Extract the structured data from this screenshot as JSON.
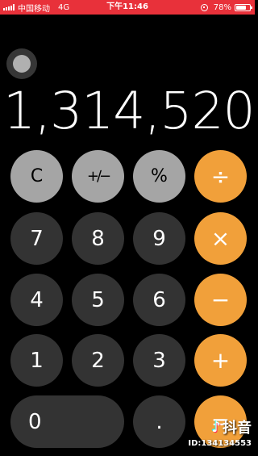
{
  "status_bar": {
    "carrier": "中国移动",
    "network": "4G",
    "time": "下午11:46",
    "battery": "78%",
    "battery_level": 0.78,
    "background_color": "#e8313a"
  },
  "display": {
    "value": "1,314,520"
  },
  "keypad": {
    "rows": [
      [
        {
          "label": "C",
          "name": "clear-button",
          "style": "gray"
        },
        {
          "label": "+∕−",
          "name": "plus-minus-button",
          "style": "gray"
        },
        {
          "label": "%",
          "name": "percent-button",
          "style": "gray"
        },
        {
          "label": "÷",
          "name": "divide-button",
          "style": "orange"
        }
      ],
      [
        {
          "label": "7",
          "name": "digit-7-button",
          "style": "dark"
        },
        {
          "label": "8",
          "name": "digit-8-button",
          "style": "dark"
        },
        {
          "label": "9",
          "name": "digit-9-button",
          "style": "dark"
        },
        {
          "label": "×",
          "name": "multiply-button",
          "style": "orange"
        }
      ],
      [
        {
          "label": "4",
          "name": "digit-4-button",
          "style": "dark"
        },
        {
          "label": "5",
          "name": "digit-5-button",
          "style": "dark"
        },
        {
          "label": "6",
          "name": "digit-6-button",
          "style": "dark"
        },
        {
          "label": "−",
          "name": "minus-button",
          "style": "orange"
        }
      ],
      [
        {
          "label": "1",
          "name": "digit-1-button",
          "style": "dark"
        },
        {
          "label": "2",
          "name": "digit-2-button",
          "style": "dark"
        },
        {
          "label": "3",
          "name": "digit-3-button",
          "style": "dark"
        },
        {
          "label": "+",
          "name": "plus-button",
          "style": "orange"
        }
      ],
      [
        {
          "label": "0",
          "name": "digit-0-button",
          "style": "dark"
        },
        {
          "label": ".",
          "name": "decimal-button",
          "style": "dark"
        },
        {
          "label": "=",
          "name": "equals-button",
          "style": "orange"
        }
      ]
    ]
  },
  "colors": {
    "function_key": "#a5a5a5",
    "digit_key": "#333333",
    "operator_key": "#f1a03a",
    "background": "#000000"
  },
  "watermark": {
    "brand": "抖音",
    "icon": "tiktok-icon",
    "id": "ID:134134553"
  }
}
